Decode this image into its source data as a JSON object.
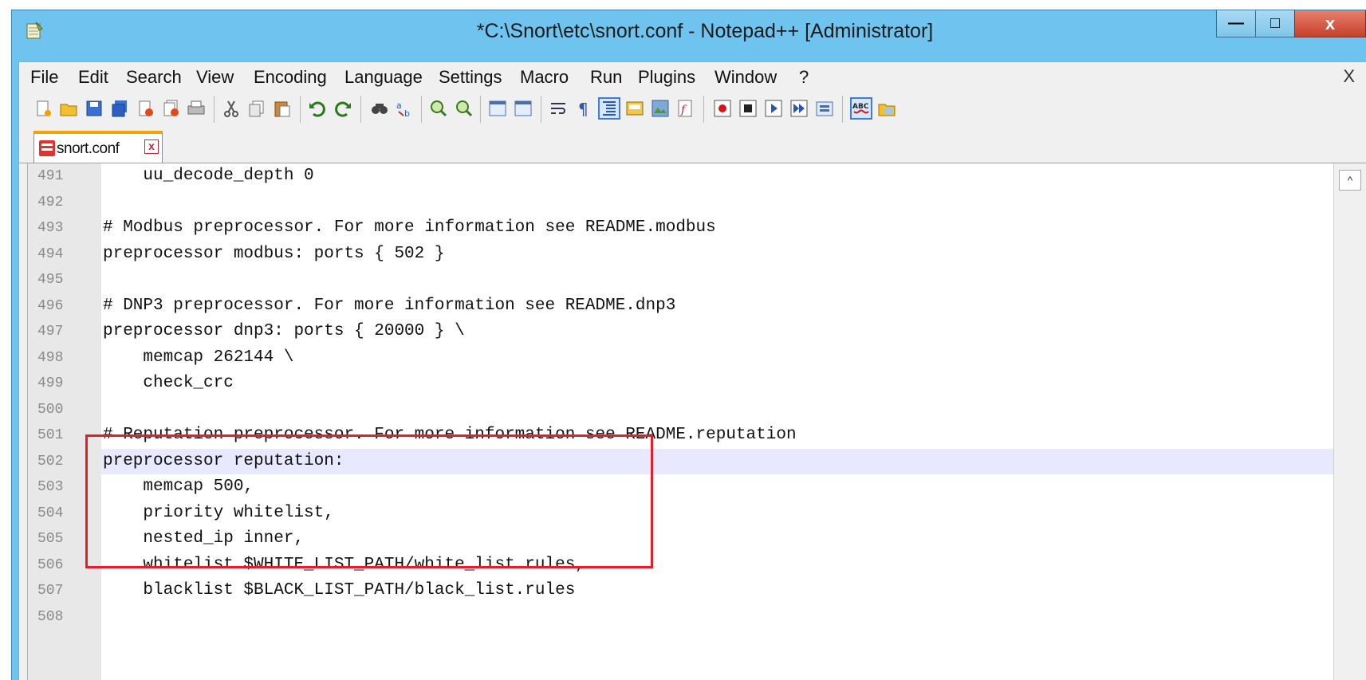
{
  "window": {
    "title": "*C:\\Snort\\etc\\snort.conf - Notepad++ [Administrator]",
    "minimize_glyph": "—",
    "maximize_glyph": "□",
    "close_glyph": "x"
  },
  "menu": {
    "items": [
      "File",
      "Edit",
      "Search",
      "View",
      "Encoding",
      "Language",
      "Settings",
      "Macro",
      "Run",
      "Plugins",
      "Window",
      "?"
    ],
    "close_label": "X"
  },
  "toolbar": {
    "icons": [
      "new-file-icon",
      "open-file-icon",
      "save-icon",
      "save-all-icon",
      "close-icon",
      "close-all-icon",
      "print-icon",
      "cut-icon",
      "copy-icon",
      "paste-icon",
      "undo-icon",
      "redo-icon",
      "find-icon",
      "replace-icon",
      "zoom-in-icon",
      "zoom-out-icon",
      "sync-vertical-icon",
      "sync-horizontal-icon",
      "word-wrap-icon",
      "show-all-chars-icon",
      "indent-guide-icon",
      "user-language-icon",
      "doc-map-icon",
      "function-list-icon",
      "record-macro-icon",
      "stop-macro-icon",
      "play-macro-icon",
      "run-macro-multiple-icon",
      "save-macro-icon",
      "spell-check-icon",
      "folder-workspace-icon"
    ]
  },
  "tab": {
    "label": "snort.conf",
    "close_glyph": "x"
  },
  "editor": {
    "lines": [
      {
        "num": "491",
        "text": "    uu_decode_depth 0"
      },
      {
        "num": "492",
        "text": ""
      },
      {
        "num": "493",
        "text": "# Modbus preprocessor. For more information see README.modbus"
      },
      {
        "num": "494",
        "text": "preprocessor modbus: ports { 502 }"
      },
      {
        "num": "495",
        "text": ""
      },
      {
        "num": "496",
        "text": "# DNP3 preprocessor. For more information see README.dnp3"
      },
      {
        "num": "497",
        "text": "preprocessor dnp3: ports { 20000 } \\"
      },
      {
        "num": "498",
        "text": "    memcap 262144 \\"
      },
      {
        "num": "499",
        "text": "    check_crc"
      },
      {
        "num": "500",
        "text": ""
      },
      {
        "num": "501",
        "text": "# Reputation preprocessor. For more information see README.reputation"
      },
      {
        "num": "502",
        "text": "preprocessor reputation:"
      },
      {
        "num": "503",
        "text": "    memcap 500,"
      },
      {
        "num": "504",
        "text": "    priority whitelist,"
      },
      {
        "num": "505",
        "text": "    nested_ip inner,"
      },
      {
        "num": "506",
        "text": "    whitelist $WHITE_LIST_PATH/white_list.rules,"
      },
      {
        "num": "507",
        "text": "    blacklist $BLACK_LIST_PATH/black_list.rules"
      },
      {
        "num": "508",
        "text": ""
      }
    ],
    "current_line": "502",
    "scroll_up_glyph": "^"
  },
  "colors": {
    "highlight_box": "#e81e25",
    "current_line": "#e8e8ff",
    "title_bar": "#6fc4ef"
  }
}
